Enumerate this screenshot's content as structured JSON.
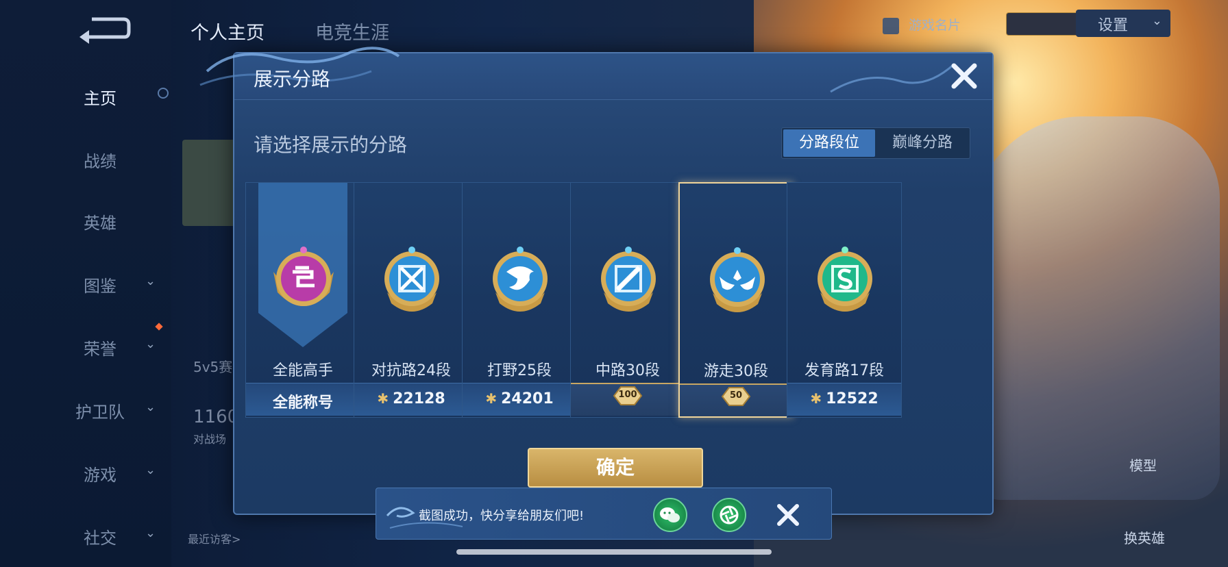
{
  "top_tabs": [
    {
      "label": "个人主页",
      "active": true
    },
    {
      "label": "电竞生涯",
      "active": false
    }
  ],
  "top_right": {
    "card_label": "游戏名片",
    "settings_label": "设置"
  },
  "sidebar": {
    "items": [
      {
        "label": "主页",
        "active": true,
        "has_chevron": false
      },
      {
        "label": "战绩",
        "has_chevron": false
      },
      {
        "label": "英雄",
        "has_chevron": false
      },
      {
        "label": "图鉴",
        "has_chevron": true
      },
      {
        "label": "荣誉",
        "has_chevron": true
      },
      {
        "label": "护卫队",
        "has_chevron": true
      },
      {
        "label": "游戏",
        "has_chevron": true
      },
      {
        "label": "社交",
        "has_chevron": true
      }
    ]
  },
  "background_text": {
    "mode": "5v5赛",
    "count": "1160",
    "count_sub": "对战场",
    "recent": "最近访客>",
    "model_btn": "模型",
    "swap_btn": "换英雄"
  },
  "modal": {
    "title": "展示分路",
    "prompt": "请选择展示的分路",
    "tabs": [
      {
        "label": "分路段位",
        "active": true
      },
      {
        "label": "巅峰分路",
        "active": false
      }
    ],
    "roles": [
      {
        "name": "全能高手",
        "footer": "全能称号",
        "footer_type": "text",
        "emblem": "all-round-emblem-icon",
        "color": "#b83ca8",
        "selected": false
      },
      {
        "name": "对抗路24段",
        "footer": "22128",
        "footer_type": "points",
        "emblem": "clash-lane-emblem-icon",
        "color": "#2d8fd6",
        "selected": false
      },
      {
        "name": "打野25段",
        "footer": "24201",
        "footer_type": "points",
        "emblem": "jungle-emblem-icon",
        "color": "#2d8fd6",
        "selected": false
      },
      {
        "name": "中路30段",
        "footer": "100",
        "footer_type": "tag",
        "emblem": "mid-lane-emblem-icon",
        "color": "#2d8fd6",
        "selected": false
      },
      {
        "name": "游走30段",
        "footer": "50",
        "footer_type": "tag",
        "emblem": "roam-emblem-icon",
        "color": "#2d8fd6",
        "selected": true
      },
      {
        "name": "发育路17段",
        "footer": "12522",
        "footer_type": "points",
        "emblem": "farm-lane-emblem-icon",
        "color": "#1fb88a",
        "selected": false
      }
    ],
    "confirm_label": "确定"
  },
  "toast": {
    "message": "截图成功，快分享给朋友们吧!",
    "share_targets": [
      "wechat-icon",
      "moments-icon"
    ]
  }
}
